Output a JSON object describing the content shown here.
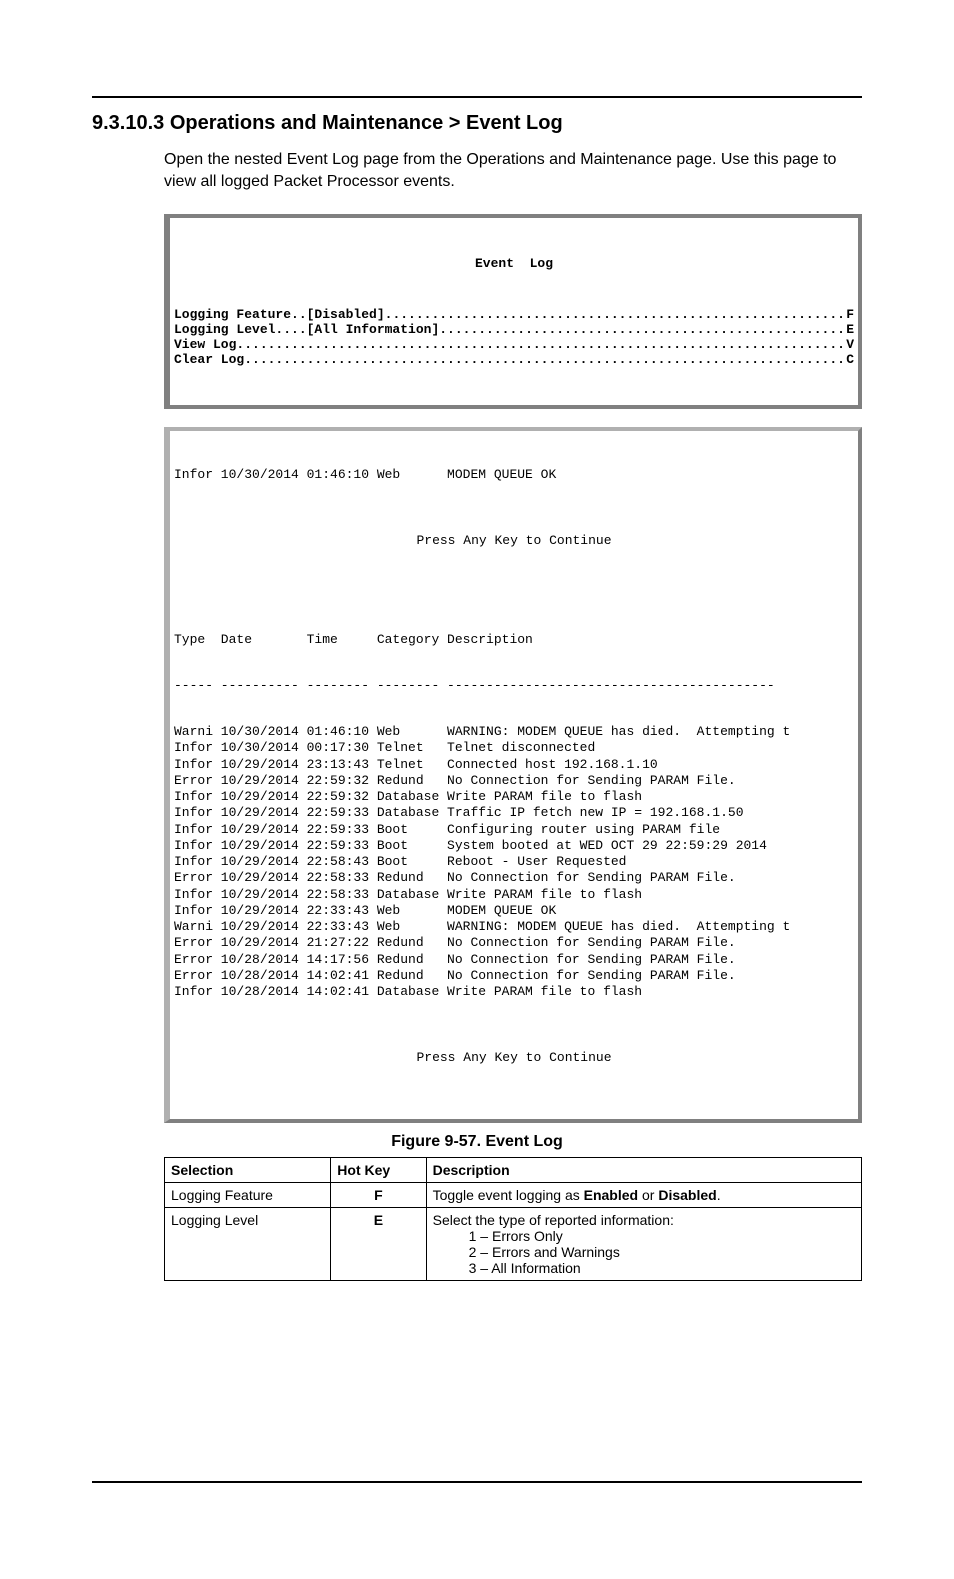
{
  "heading": "9.3.10.3   Operations and Maintenance > Event Log",
  "intro": "Open the nested Event Log page from the Operations and Maintenance page. Use this page to view  all logged Packet Processor events.",
  "menu": {
    "title": "Event  Log",
    "items": [
      {
        "label": "Logging Feature..[Disabled]",
        "key": "F"
      },
      {
        "label": "Logging Level....[All Information]",
        "key": "E"
      },
      {
        "label": "View Log",
        "key": "V"
      },
      {
        "label": "Clear Log",
        "key": "C"
      }
    ]
  },
  "log": {
    "top_line": "Infor 10/30/2014 01:46:10 Web      MODEM QUEUE OK",
    "prompt": "Press Any Key to Continue",
    "header": "Type  Date       Time     Category Description",
    "rule": "----- ---------- -------- -------- ------------------------------------------",
    "rows": [
      "Warni 10/30/2014 01:46:10 Web      WARNING: MODEM QUEUE has died.  Attempting t",
      "Infor 10/30/2014 00:17:30 Telnet   Telnet disconnected",
      "Infor 10/29/2014 23:13:43 Telnet   Connected host 192.168.1.10",
      "Error 10/29/2014 22:59:32 Redund   No Connection for Sending PARAM File.",
      "Infor 10/29/2014 22:59:32 Database Write PARAM file to flash",
      "Infor 10/29/2014 22:59:33 Database Traffic IP fetch new IP = 192.168.1.50",
      "Infor 10/29/2014 22:59:33 Boot     Configuring router using PARAM file",
      "Infor 10/29/2014 22:59:33 Boot     System booted at WED OCT 29 22:59:29 2014",
      "Infor 10/29/2014 22:58:43 Boot     Reboot - User Requested",
      "Error 10/29/2014 22:58:33 Redund   No Connection for Sending PARAM File.",
      "Infor 10/29/2014 22:58:33 Database Write PARAM file to flash",
      "Infor 10/29/2014 22:33:43 Web      MODEM QUEUE OK",
      "Warni 10/29/2014 22:33:43 Web      WARNING: MODEM QUEUE has died.  Attempting t",
      "Error 10/29/2014 21:27:22 Redund   No Connection for Sending PARAM File.",
      "Error 10/28/2014 14:17:56 Redund   No Connection for Sending PARAM File.",
      "Error 10/28/2014 14:02:41 Redund   No Connection for Sending PARAM File.",
      "Infor 10/28/2014 14:02:41 Database Write PARAM file to flash"
    ]
  },
  "figure_caption": "Figure 9-57. Event Log",
  "table": {
    "headers": {
      "selection": "Selection",
      "hotkey": "Hot Key",
      "description": "Description"
    },
    "rows": [
      {
        "selection": "Logging Feature",
        "hotkey": "F",
        "desc_pre": "Toggle event logging as ",
        "desc_b1": "Enabled",
        "desc_mid": " or ",
        "desc_b2": "Disabled",
        "desc_post": "."
      },
      {
        "selection": "Logging Level",
        "hotkey": "E",
        "desc_intro": "Select the type of reported information:",
        "opt1": "1 – Errors Only",
        "opt2": "2 – Errors and Warnings",
        "opt3": "3 – All Information"
      }
    ]
  }
}
